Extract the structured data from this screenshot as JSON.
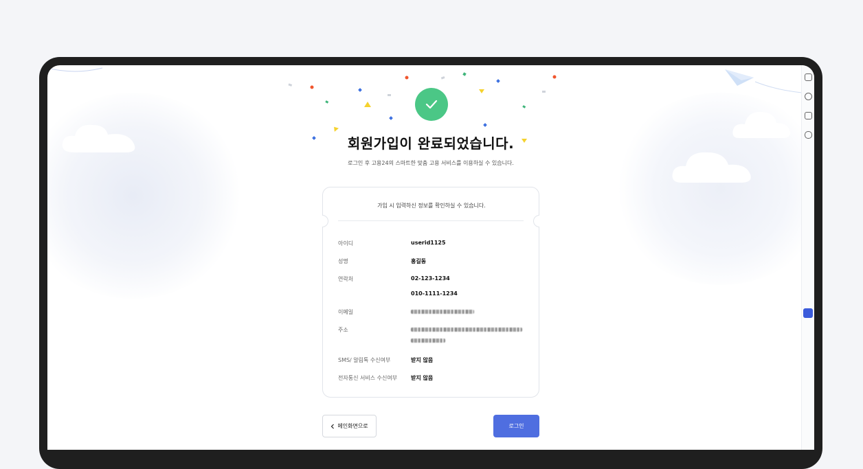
{
  "header": {
    "title": "회원가입이 완료되었습니다.",
    "subtitle": "로그인 후 고용24의 스마트한 맞춤 고용 서비스를 이용하실 수 있습니다."
  },
  "card": {
    "heading": "가입 시 입력하신 정보를 확인하실 수 있습니다.",
    "rows": [
      {
        "label": "아이디",
        "value": "userid1125"
      },
      {
        "label": "성명",
        "value": "홍길동"
      },
      {
        "label": "연락처",
        "value": "02-123-1234"
      },
      {
        "label": "",
        "value": "010-1111-1234"
      },
      {
        "label": "이메일",
        "value": ""
      },
      {
        "label": "주소",
        "value": ""
      },
      {
        "label": "SMS/ 알림톡 수신여부",
        "value": "받지 않음"
      },
      {
        "label": "전자통신 서비스 수신여부",
        "value": "받지 않음"
      }
    ]
  },
  "buttons": {
    "back_label": "메인화면으로",
    "login_label": "로그인"
  },
  "icons": [
    "check-icon",
    "chevron-left-icon",
    "cloud-icon",
    "paper-plane-icon"
  ],
  "colors": {
    "success": "#4bc786",
    "primary": "#4f6ee0",
    "confetti_blue": "#3b6fe0",
    "confetti_orange": "#f0562e",
    "confetti_yellow": "#f5d22e",
    "confetti_green": "#3fb57a"
  }
}
